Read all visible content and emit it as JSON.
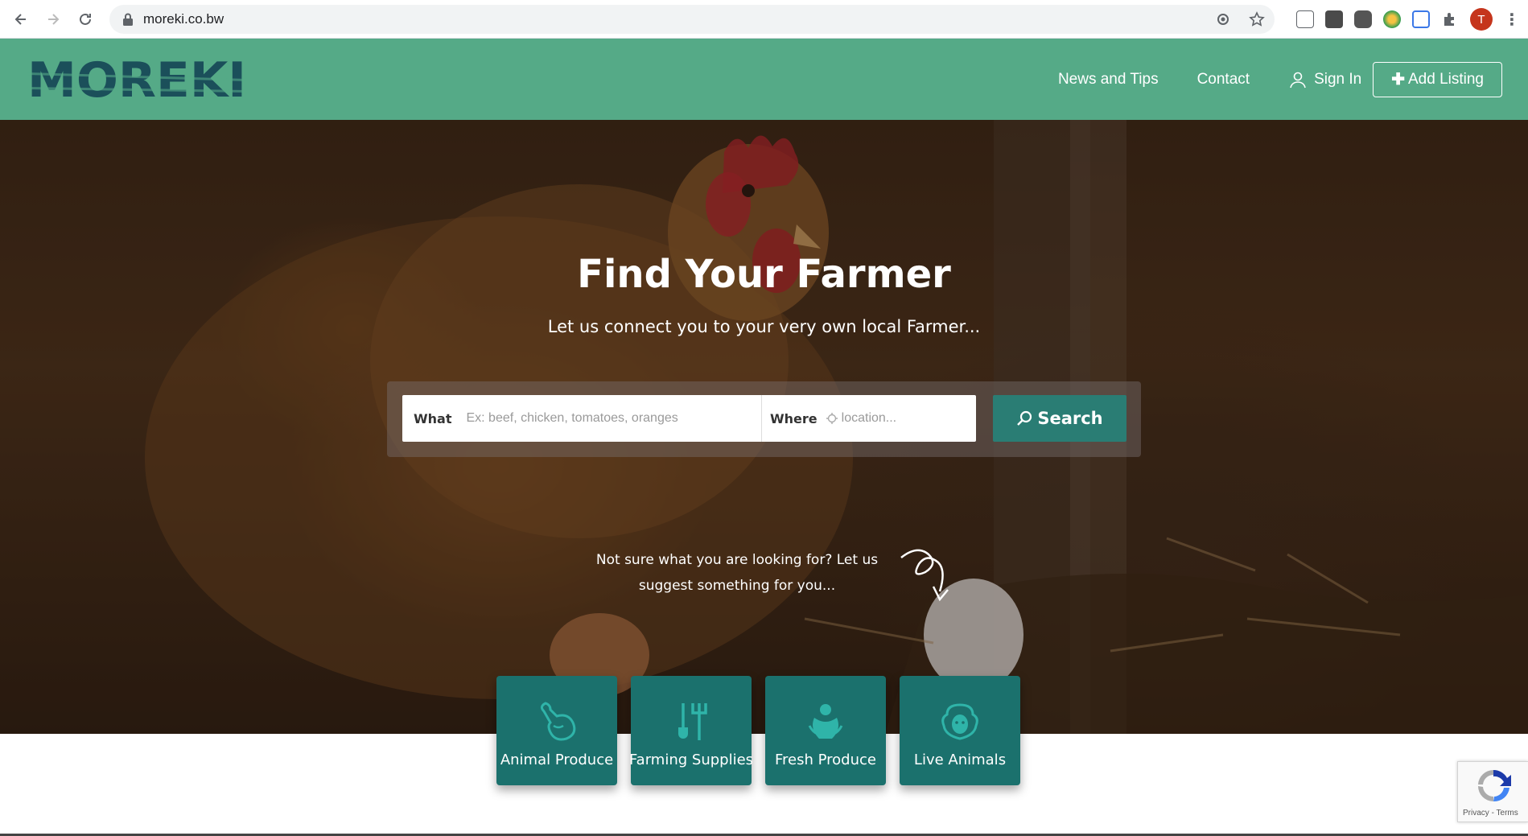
{
  "browser": {
    "url": "moreki.co.bw",
    "profile_initial": "T"
  },
  "header": {
    "logo_text": "MOREKI",
    "nav": {
      "news": "News and Tips",
      "contact": "Contact",
      "sign_in": "Sign In",
      "add_listing": "Add Listing"
    }
  },
  "hero": {
    "title": "Find Your Farmer",
    "subtitle": "Let us connect you to your very own local Farmer...",
    "search": {
      "what_label": "What",
      "what_placeholder": "Ex: beef, chicken, tomatoes, oranges",
      "where_label": "Where",
      "where_placeholder": "location...",
      "button_label": "Search"
    },
    "suggest_text": "Not sure what you are looking for? Let us suggest something for you..."
  },
  "categories": [
    {
      "label": "Animal Produce",
      "icon": "chicken-leg-icon"
    },
    {
      "label": "Farming Supplies",
      "icon": "farm-tools-icon"
    },
    {
      "label": "Fresh Produce",
      "icon": "vegetables-icon"
    },
    {
      "label": "Live Animals",
      "icon": "sheep-icon"
    }
  ],
  "recaptcha": {
    "privacy": "Privacy",
    "terms": "Terms"
  },
  "colors": {
    "header_green": "#55aa87",
    "teal": "#1b716d",
    "search_button": "#2a7d74",
    "logo": "#1b4f5a"
  }
}
